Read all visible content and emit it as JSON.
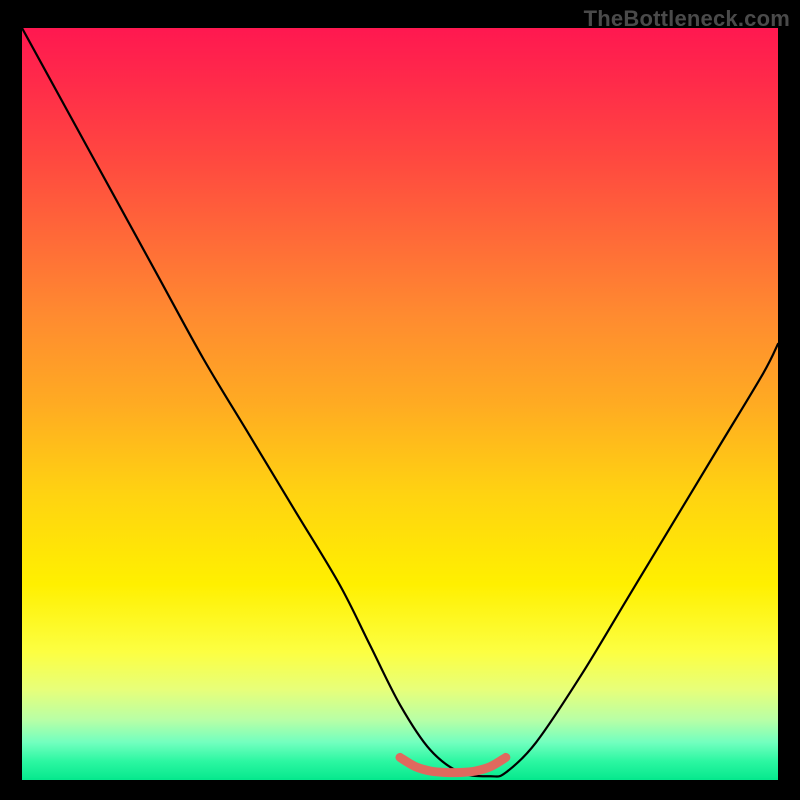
{
  "watermark": "TheBottleneck.com",
  "chart_data": {
    "type": "line",
    "title": "",
    "xlabel": "",
    "ylabel": "",
    "xlim": [
      0,
      100
    ],
    "ylim": [
      0,
      100
    ],
    "series": [
      {
        "name": "black-curve",
        "color": "#000000",
        "x": [
          0,
          6,
          12,
          18,
          24,
          30,
          36,
          42,
          46,
          50,
          54,
          58,
          62,
          64,
          68,
          74,
          80,
          86,
          92,
          98,
          100
        ],
        "y": [
          100,
          89,
          78,
          67,
          56,
          46,
          36,
          26,
          18,
          10,
          4,
          1,
          0.5,
          1,
          5,
          14,
          24,
          34,
          44,
          54,
          58
        ]
      },
      {
        "name": "red-flat-segment",
        "color": "#e0695e",
        "x": [
          50,
          52,
          54,
          56,
          58,
          60,
          62,
          64
        ],
        "y": [
          3.0,
          1.8,
          1.2,
          1.0,
          1.0,
          1.2,
          1.8,
          3.0
        ]
      }
    ],
    "gradient_stops": [
      {
        "pos": 0,
        "color": "#ff1850"
      },
      {
        "pos": 17,
        "color": "#ff4740"
      },
      {
        "pos": 38,
        "color": "#ff8a30"
      },
      {
        "pos": 62,
        "color": "#ffd311"
      },
      {
        "pos": 83,
        "color": "#fcff42"
      },
      {
        "pos": 95,
        "color": "#72ffbf"
      },
      {
        "pos": 100,
        "color": "#06e88d"
      }
    ]
  }
}
